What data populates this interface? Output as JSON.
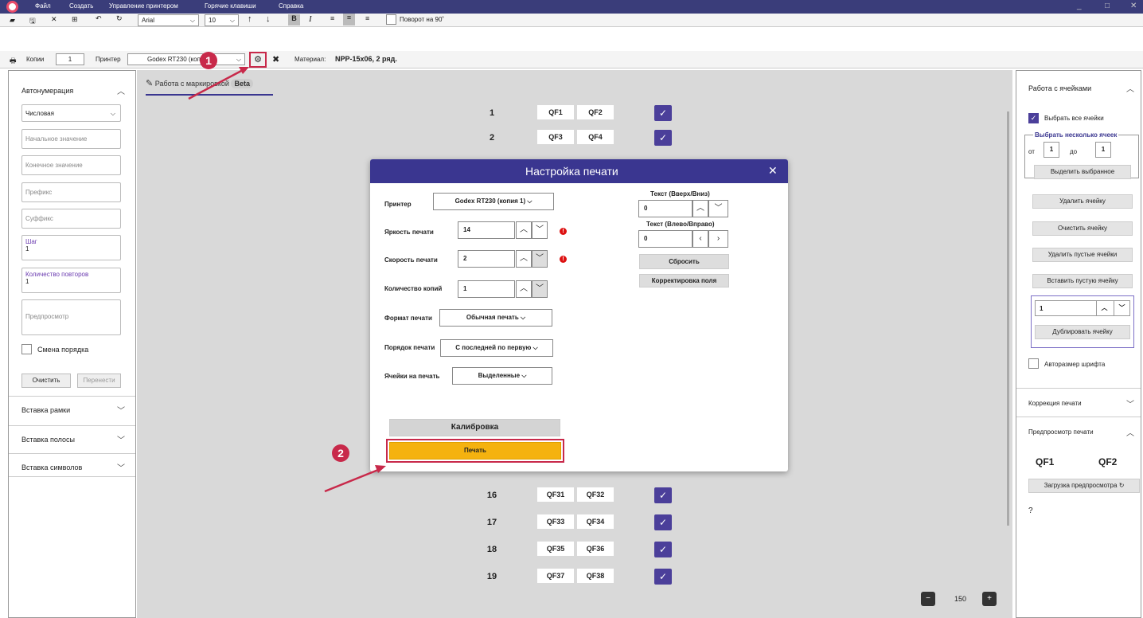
{
  "menu": {
    "items": [
      "Файл",
      "Создать",
      "Управление принтером",
      "Горячие клавиши",
      "Справка"
    ]
  },
  "toolbar": {
    "font": "Arial",
    "size": "10",
    "bold": "B",
    "italic": "I",
    "rotate_label": "Поворот на 90˚"
  },
  "toolbar2": {
    "copies_label": "Копии",
    "copies_value": "1",
    "printer_label": "Принтер",
    "printer_value": "Godex RT230 (копия 1)",
    "material_label": "Материал:",
    "material_value": "NPP-15x06, 2 ряд."
  },
  "left": {
    "autonum": "Автонумерация",
    "type": "Числовая",
    "start_ph": "Начальное значение",
    "end_ph": "Конечное значение",
    "prefix_ph": "Префикс",
    "suffix_ph": "Суффикс",
    "step_label": "Шаг",
    "step_value": "1",
    "repeat_label": "Количество повторов",
    "repeat_value": "1",
    "preview_ph": "Предпросмотр",
    "order_change": "Смена порядка",
    "clear": "Очистить",
    "transfer": "Перенести",
    "frame": "Вставка рамки",
    "stripe": "Вставка полосы",
    "symbols": "Вставка символов"
  },
  "center": {
    "tab_label": "Работа с маркировкой",
    "tab_badge": "Beta",
    "rows": [
      {
        "n": "1",
        "a": "QF1",
        "b": "QF2"
      },
      {
        "n": "2",
        "a": "QF3",
        "b": "QF4"
      },
      {
        "n": "16",
        "a": "QF31",
        "b": "QF32"
      },
      {
        "n": "17",
        "a": "QF33",
        "b": "QF34"
      },
      {
        "n": "18",
        "a": "QF35",
        "b": "QF36"
      },
      {
        "n": "19",
        "a": "QF37",
        "b": "QF38"
      }
    ],
    "zoom": "150"
  },
  "right": {
    "cells_hdr": "Работа с ячейками",
    "select_all": "Выбрать все ячейки",
    "select_some": "Выбрать несколько ячеек",
    "from_label": "от",
    "from_value": "1",
    "to_label": "до",
    "to_value": "1",
    "select_btn": "Выделить выбранное",
    "delete_cell": "Удалить ячейку",
    "clear_cell": "Очистить ячейку",
    "delete_empty": "Удалить пустые ячейки",
    "insert_empty": "Вставить пустую ячейку",
    "dup_value": "1",
    "dup_btn": "Дублировать ячейку",
    "autosize": "Авторазмер шрифта",
    "correction": "Коррекция печати",
    "preview_hdr": "Предпросмотр печати",
    "prev_a": "QF1",
    "prev_b": "QF2",
    "load_preview": "Загрузка предпросмотра"
  },
  "modal": {
    "title": "Настройка печати",
    "printer_label": "Принтер",
    "printer_value": "Godex RT230 (копия 1)",
    "brightness_label": "Яркость печати",
    "brightness_value": "14",
    "speed_label": "Скорость печати",
    "speed_value": "2",
    "copies_label": "Количество копий",
    "copies_value": "1",
    "format_label": "Формат печати",
    "format_value": "Обычная печать",
    "order_label": "Порядок печати",
    "order_value": "С последней по первую",
    "cells_label": "Ячейки на печать",
    "cells_value": "Выделенные",
    "text_vert_label": "Текст (Вверх/Вниз)",
    "text_vert_value": "0",
    "text_horiz_label": "Текст (Влево/Вправо)",
    "text_horiz_value": "0",
    "reset": "Сбросить",
    "field_corr": "Корректировка поля",
    "calibrate": "Калибровка",
    "print": "Печать"
  },
  "annotations": {
    "one": "1",
    "two": "2"
  },
  "colors": {
    "accent": "#3a3690",
    "print_btn": "#f5b20f",
    "annotation": "#c8294a"
  }
}
